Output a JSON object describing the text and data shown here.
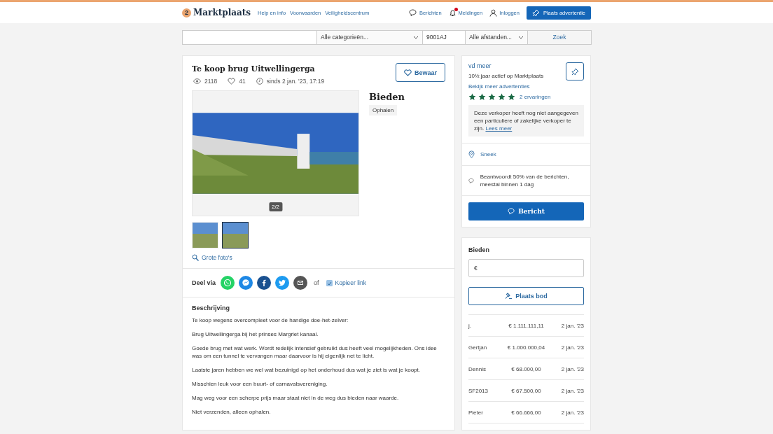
{
  "header": {
    "logo_badge": "2",
    "logo_text": "Marktplaats",
    "links": [
      "Help en info",
      "Voorwaarden",
      "Veiligheidscentrum"
    ],
    "actions": [
      {
        "kind": "messages",
        "label": "Berichten",
        "notification": false
      },
      {
        "kind": "notifications",
        "label": "Meldingen",
        "notification": true
      },
      {
        "kind": "login",
        "label": "Inloggen",
        "notification": false
      }
    ],
    "cta": "Plaats advertentie"
  },
  "search": {
    "category": "Alle categorieën...",
    "postcode": "9001AJ",
    "distance": "Alle afstanden...",
    "button": "Zoek"
  },
  "listing": {
    "title": "Te koop brug Uitwellingerga",
    "save_button": "Bewaar",
    "views": "2118",
    "favorites": "41",
    "since": "sinds 2 jan. '23, 17:19",
    "photo_counter": "2/2",
    "thumbnails": [
      {
        "selected": false
      },
      {
        "selected": true
      }
    ],
    "large_photos_link": "Grote foto's",
    "price_label": "Bieden",
    "delivery_tag": "Ophalen",
    "share_label": "Deel via",
    "share": [
      {
        "kind": "whatsapp",
        "color": "#25d366"
      },
      {
        "kind": "messenger",
        "color": "#1e88e5"
      },
      {
        "kind": "facebook",
        "color": "#1a5190"
      },
      {
        "kind": "twitter",
        "color": "#1d9bf0"
      },
      {
        "kind": "email",
        "color": "#555555"
      }
    ],
    "share_or": "of",
    "copy_link": "Kopieer link",
    "description_title": "Beschrijving",
    "description": [
      "Te koop wegens overcompleet voor de handige doe-het-zelver:",
      "Brug Uitwellingerga bij het prinses Margriet kanaal.",
      "Goede brug met wat werk. Wordt redelijk intensief gebruikt dus heeft veel mogelijkheden. Ons idee was om een tunnel te vervangen maar daarvoor is hij eigenlijk net te licht.",
      "Laatste jaren hebben we wel wat bezuinigd op het onderhoud dus wat je ziet is wat je koopt.",
      "Misschien leuk voor een buurt- of carnavalsvereniging.",
      "Mag weg voor een scherpe prijs maar staat niet in de weg dus bieden naar waarde.",
      "Niet verzenden, alleen ophalen."
    ]
  },
  "seller": {
    "name": "vd meer",
    "active": "10½ jaar actief op Marktplaats",
    "more_ads": "Bekijk meer advertenties",
    "stars": 5,
    "reviews": "2 ervaringen",
    "notice": "Deze verkoper heeft nog niet aangegeven een particuliere of zakelijke verkoper te zijn.",
    "notice_link": "Lees meer",
    "location": "Sneek",
    "response": "Beantwoordt 50% van de berichten, meestal binnen 1 dag",
    "message_button": "Bericht"
  },
  "bidding": {
    "title": "Bieden",
    "currency": "€",
    "place_bid": "Plaats bod",
    "bids": [
      {
        "name": "j.",
        "amount": "€ 1.111.111,11",
        "date": "2 jan. '23"
      },
      {
        "name": "Gertjan",
        "amount": "€ 1.000.000,04",
        "date": "2 jan. '23"
      },
      {
        "name": "Dennis",
        "amount": "€ 68.000,00",
        "date": "2 jan. '23"
      },
      {
        "name": "SF2013",
        "amount": "€ 67.500,00",
        "date": "2 jan. '23"
      },
      {
        "name": "Pieter",
        "amount": "€ 66.666,00",
        "date": "2 jan. '23"
      }
    ]
  }
}
